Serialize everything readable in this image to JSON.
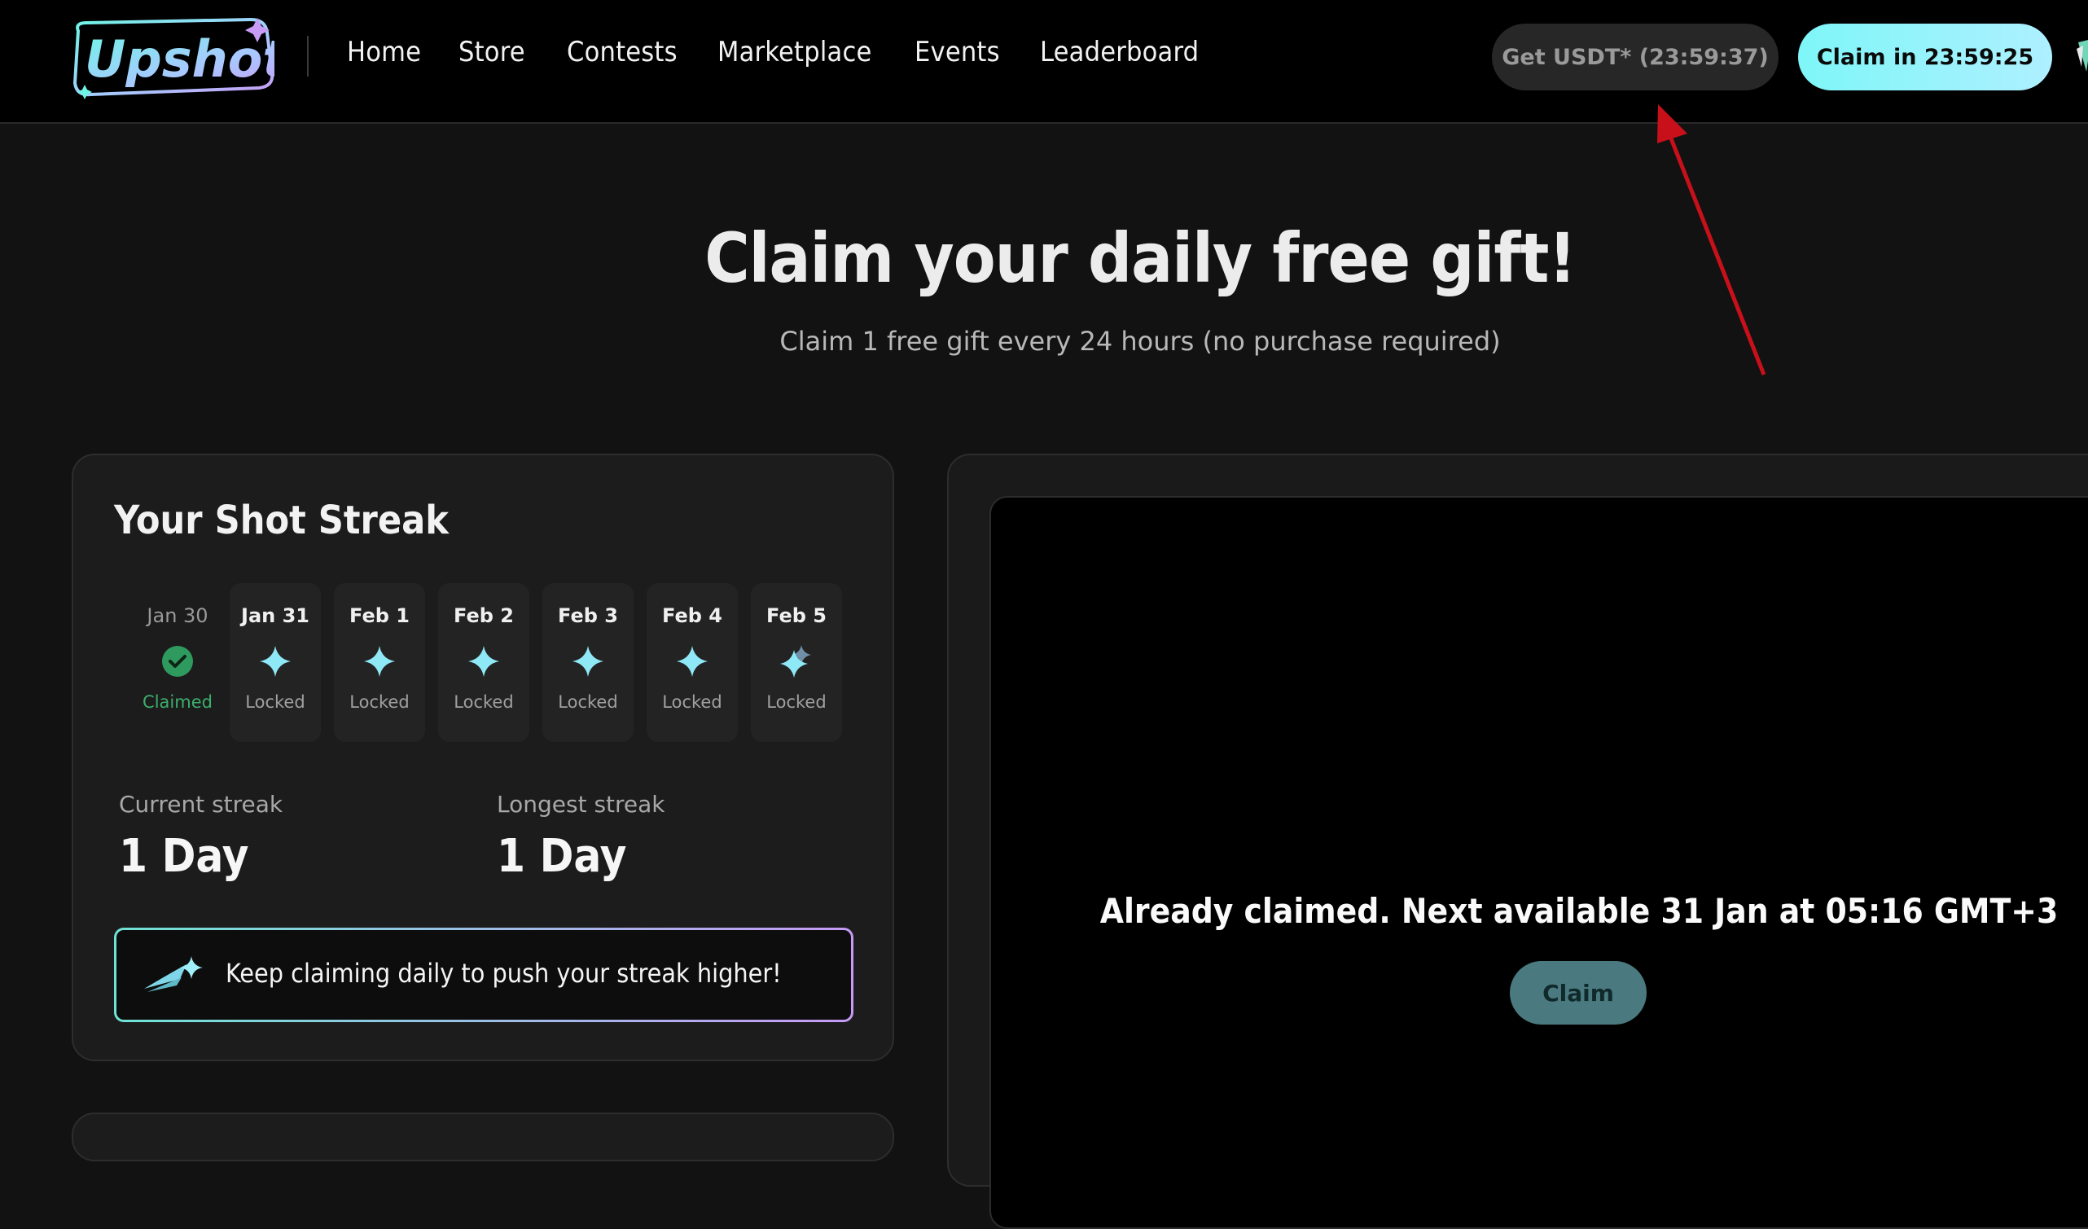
{
  "brand": {
    "name": "Upshot"
  },
  "nav": {
    "items": [
      {
        "label": "Home"
      },
      {
        "label": "Store"
      },
      {
        "label": "Contests"
      },
      {
        "label": "Marketplace"
      },
      {
        "label": "Events"
      },
      {
        "label": "Leaderboard"
      }
    ]
  },
  "header": {
    "usdt_button": "Get USDT* (23:59:37)",
    "claim_button": "Claim in 23:59:25"
  },
  "hero": {
    "title": "Claim your daily free gift!",
    "subtitle": "Claim 1 free gift every 24 hours (no purchase required)"
  },
  "streak": {
    "title": "Your Shot Streak",
    "days": [
      {
        "date": "Jan 30",
        "status": "Claimed",
        "icon": "check-circle-icon"
      },
      {
        "date": "Jan 31",
        "status": "Locked",
        "icon": "sparkle-icon"
      },
      {
        "date": "Feb 1",
        "status": "Locked",
        "icon": "sparkle-icon"
      },
      {
        "date": "Feb 2",
        "status": "Locked",
        "icon": "sparkle-icon"
      },
      {
        "date": "Feb 3",
        "status": "Locked",
        "icon": "sparkle-icon"
      },
      {
        "date": "Feb 4",
        "status": "Locked",
        "icon": "sparkle-icon"
      },
      {
        "date": "Feb 5",
        "status": "Locked",
        "icon": "double-sparkle-icon"
      }
    ],
    "current_label": "Current streak",
    "current_value": "1 Day",
    "longest_label": "Longest streak",
    "longest_value": "1 Day",
    "tip": "Keep claiming daily to push your streak higher!"
  },
  "gift": {
    "message": "Already claimed. Next available 31 Jan at 05:16 GMT+3",
    "claim_button": "Claim"
  },
  "colors": {
    "accent_cyan": "#7ef6f8",
    "claimed_green": "#3cae6c",
    "annotation_red": "#c8101a"
  }
}
